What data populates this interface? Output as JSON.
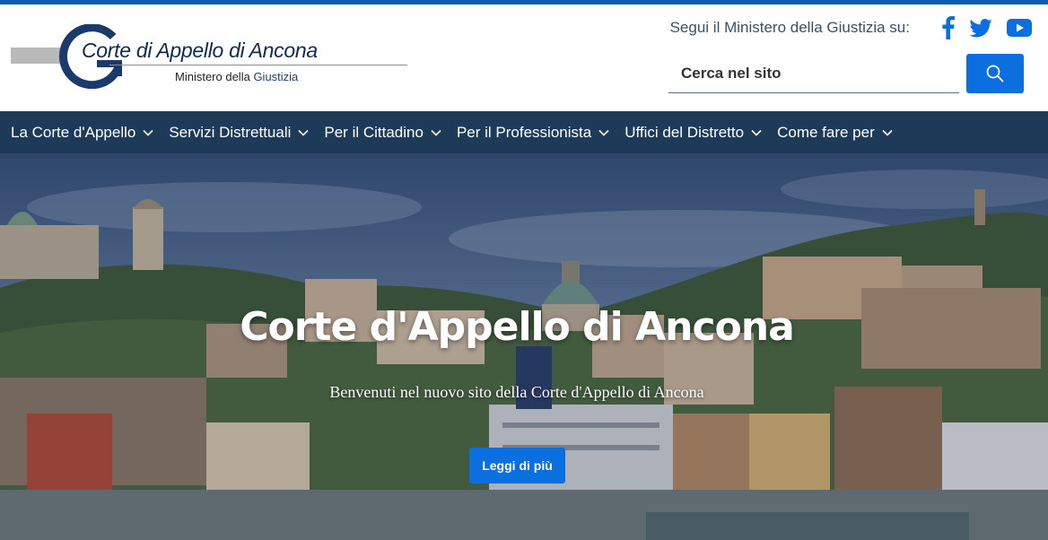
{
  "brand": {
    "title": "Corte di Appello di Ancona",
    "subtitle_prefix": "Ministero della ",
    "subtitle_accent": "Giustizia",
    "logo_icon": "g-logo-icon"
  },
  "social": {
    "label": "Segui il Ministero della Giustizia su:",
    "links": [
      {
        "icon": "facebook-icon"
      },
      {
        "icon": "twitter-icon"
      },
      {
        "icon": "youtube-icon"
      }
    ]
  },
  "search": {
    "placeholder": "Cerca nel sito",
    "icon": "search-icon"
  },
  "nav": {
    "items": [
      {
        "label": "La Corte d'Appello"
      },
      {
        "label": "Servizi Distrettuali"
      },
      {
        "label": "Per il Cittadino"
      },
      {
        "label": "Per il Professionista"
      },
      {
        "label": "Uffici del Distretto"
      },
      {
        "label": "Come fare per"
      }
    ]
  },
  "hero": {
    "title": "Corte d'Appello di Ancona",
    "tagline": "Benvenuti nel nuovo sito della Corte d'Appello di Ancona",
    "cta_label": "Leggi di più"
  },
  "colors": {
    "accent_blue": "#0b6fe0",
    "nav_bg": "#1d3a58",
    "top_bar": "#0b5cad",
    "brand_navy": "#0f2a52"
  }
}
